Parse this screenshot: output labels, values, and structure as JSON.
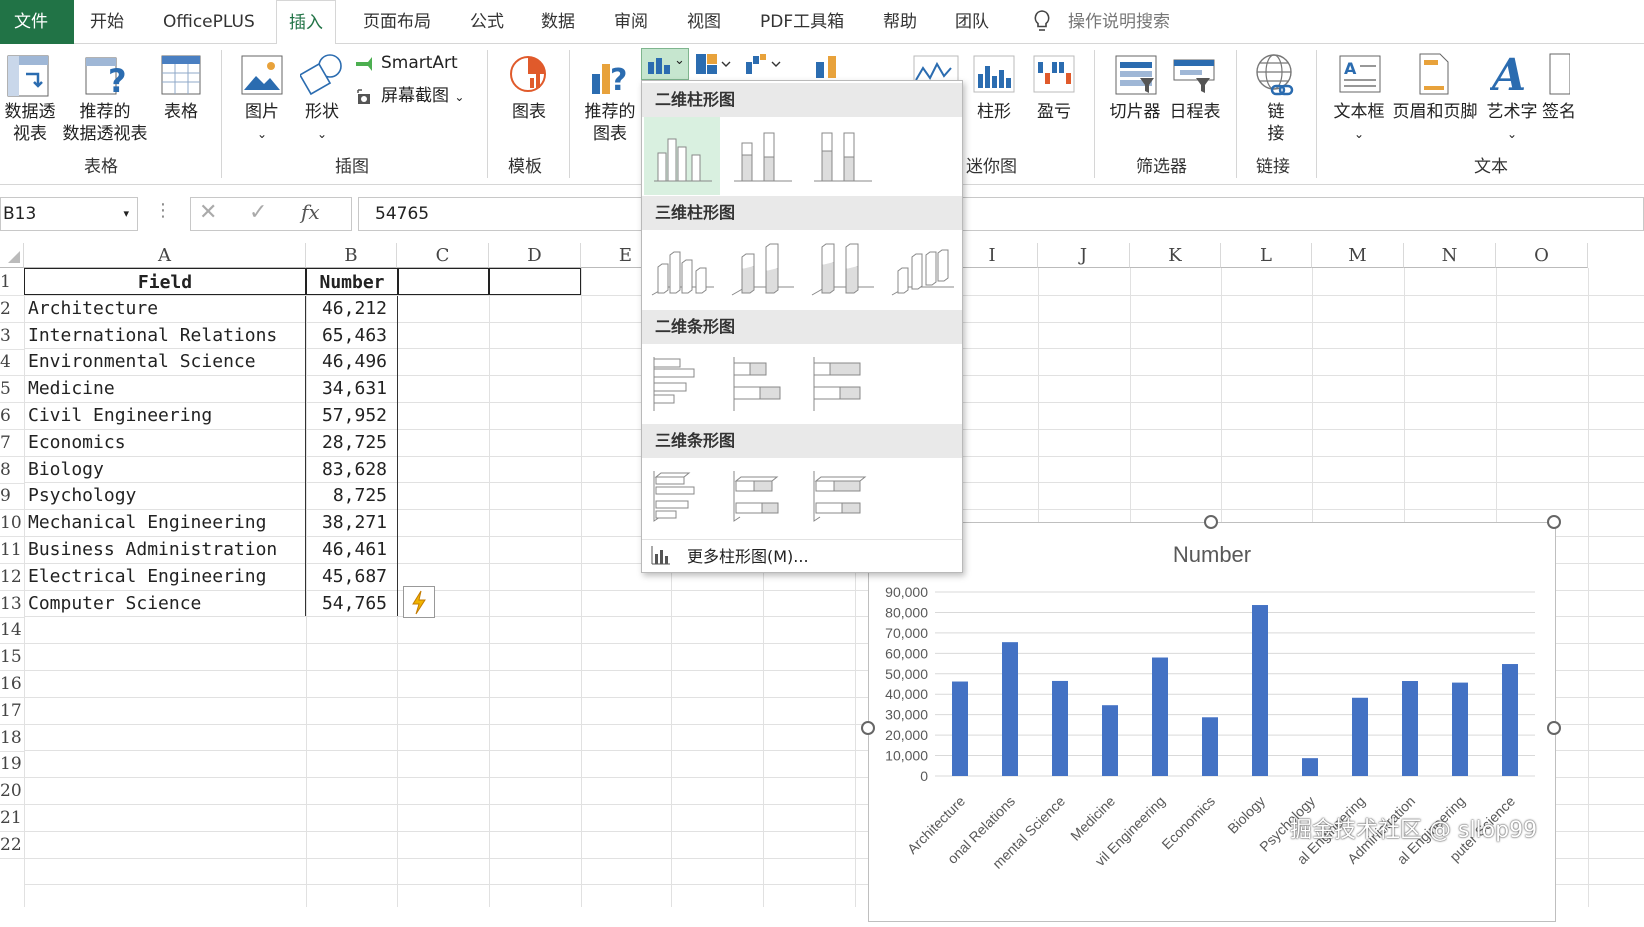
{
  "tabs": {
    "file": "文件",
    "items": [
      "开始",
      "OfficePLUS",
      "插入",
      "页面布局",
      "公式",
      "数据",
      "审阅",
      "视图",
      "PDF工具箱",
      "帮助",
      "团队"
    ],
    "active": "插入",
    "search": "操作说明搜索"
  },
  "ribbon": {
    "pivot_l1": "数据透",
    "pivot_l2": "视表",
    "rec_pivot_l1": "推荐的",
    "rec_pivot_l2": "数据透视表",
    "table": "表格",
    "picture": "图片",
    "shapes": "形状",
    "smartart": "SmartArt",
    "screenshot": "屏幕截图",
    "chart_template": "图表",
    "rec_chart_l1": "推荐的",
    "rec_chart_l2": "图表",
    "spark_column": "柱形",
    "spark_winloss": "盈亏",
    "slicer": "切片器",
    "timeline": "日程表",
    "link_l1": "链",
    "link_l2": "接",
    "textbox": "文本框",
    "header_footer": "页眉和页脚",
    "wordart": "艺术字",
    "signature": "签名",
    "groups": {
      "tables": "表格",
      "illustrations": "插图",
      "templates": "模板",
      "sparklines": "迷你图",
      "filters": "筛选器",
      "links": "链接",
      "text": "文本"
    }
  },
  "formula_bar": {
    "name_box": "B13",
    "formula": "54765"
  },
  "columns": [
    "A",
    "B",
    "C",
    "D",
    "E",
    "I",
    "J",
    "K",
    "L",
    "M",
    "N",
    "O"
  ],
  "rows": [
    "1",
    "2",
    "3",
    "4",
    "5",
    "6",
    "7",
    "8",
    "9",
    "10",
    "11",
    "12",
    "13",
    "14",
    "15",
    "16",
    "17",
    "18",
    "19",
    "20",
    "21",
    "22"
  ],
  "sheet": {
    "header_field": "Field",
    "header_number": "Number",
    "records": [
      {
        "field": "Architecture",
        "number": "46,212"
      },
      {
        "field": "International Relations",
        "number": "65,463"
      },
      {
        "field": "Environmental Science",
        "number": "46,496"
      },
      {
        "field": "Medicine",
        "number": "34,631"
      },
      {
        "field": "Civil Engineering",
        "number": "57,952"
      },
      {
        "field": "Economics",
        "number": "28,725"
      },
      {
        "field": "Biology",
        "number": "83,628"
      },
      {
        "field": "Psychology",
        "number": "8,725"
      },
      {
        "field": "Mechanical Engineering",
        "number": "38,271"
      },
      {
        "field": "Business Administration",
        "number": "46,461"
      },
      {
        "field": "Electrical Engineering",
        "number": "45,687"
      },
      {
        "field": "Computer Science",
        "number": "54,765"
      }
    ]
  },
  "dropdown": {
    "sec_2d_column": "二维柱形图",
    "sec_3d_column": "三维柱形图",
    "sec_2d_bar": "二维条形图",
    "sec_3d_bar": "三维条形图",
    "more": "更多柱形图(M)..."
  },
  "chart_data": {
    "type": "bar",
    "title": "Number",
    "categories": [
      "Architecture",
      "International Relations",
      "Environmental Science",
      "Medicine",
      "Civil Engineering",
      "Economics",
      "Biology",
      "Psychology",
      "Mechanical Engineering",
      "Business Administration",
      "Electrical Engineering",
      "Computer Science"
    ],
    "visible_labels": [
      "Architecture",
      "onal Relations",
      "mental Science",
      "Medicine",
      "vil Engineering",
      "Economics",
      "Biology",
      "Psychology",
      "al Engineering",
      "Administration",
      "al Engineering",
      "puter Science"
    ],
    "values": [
      46212,
      65463,
      46496,
      34631,
      57952,
      28725,
      83628,
      8725,
      38271,
      46461,
      45687,
      54765
    ],
    "ylim": [
      0,
      90000
    ],
    "yticks": [
      "90,000",
      "80,000",
      "70,000",
      "60,000",
      "50,000",
      "40,000",
      "30,000",
      "20,000",
      "10,000",
      "0"
    ],
    "color": "#4472C4",
    "grid": true
  },
  "watermark": "掘金技术社区 @ sllop99"
}
